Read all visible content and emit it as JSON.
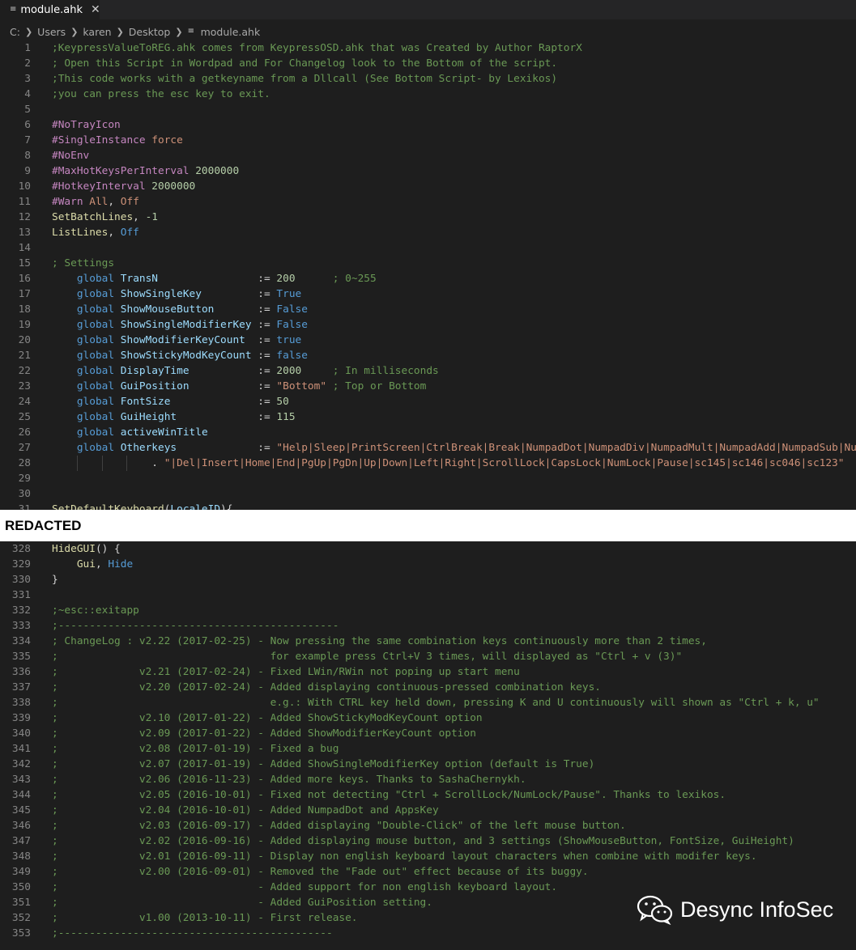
{
  "tab": {
    "icon": "file-lines-icon",
    "label": "module.ahk",
    "close_icon": "close-icon"
  },
  "breadcrumb": [
    "C:",
    "Users",
    "karen",
    "Desktop",
    "module.ahk"
  ],
  "redacted_label": "REDACTED",
  "watermark": {
    "icon": "wechat-icon",
    "text": "Desync InfoSec"
  },
  "colors": {
    "background": "#1e1e1e",
    "comment": "#6a9955",
    "directive": "#c586c0",
    "number": "#b5cea8",
    "string": "#ce9178",
    "keyword": "#569cd6",
    "function": "#dcdcaa",
    "line_number": "#858585"
  },
  "code_top": [
    {
      "n": "1",
      "t": ";KeypressValueToREG.ahk comes from KeypressOSD.ahk that was Created by Author RaptorX"
    },
    {
      "n": "2",
      "t": "; Open this Script in Wordpad and For Changelog look to the Bottom of the script."
    },
    {
      "n": "3",
      "t": ";This code works with a getkeyname from a Dllcall (See Bottom Script- by Lexikos)"
    },
    {
      "n": "4",
      "t": ";you can press the esc key to exit."
    },
    {
      "n": "5",
      "t": ""
    },
    {
      "n": "6",
      "t": "#NoTrayIcon"
    },
    {
      "n": "7",
      "t": "#SingleInstance force"
    },
    {
      "n": "8",
      "t": "#NoEnv"
    },
    {
      "n": "9",
      "t": "#MaxHotKeysPerInterval 2000000"
    },
    {
      "n": "10",
      "t": "#HotkeyInterval 2000000"
    },
    {
      "n": "11",
      "t": "#Warn All, Off"
    },
    {
      "n": "12",
      "t": "SetBatchLines, -1"
    },
    {
      "n": "13",
      "t": "ListLines, Off"
    },
    {
      "n": "14",
      "t": ""
    },
    {
      "n": "15",
      "t": "; Settings"
    },
    {
      "n": "16",
      "t": "    global TransN                := 200      ; 0~255"
    },
    {
      "n": "17",
      "t": "    global ShowSingleKey         := True"
    },
    {
      "n": "18",
      "t": "    global ShowMouseButton       := False"
    },
    {
      "n": "19",
      "t": "    global ShowSingleModifierKey := False"
    },
    {
      "n": "20",
      "t": "    global ShowModifierKeyCount  := true"
    },
    {
      "n": "21",
      "t": "    global ShowStickyModKeyCount := false"
    },
    {
      "n": "22",
      "t": "    global DisplayTime           := 2000     ; In milliseconds"
    },
    {
      "n": "23",
      "t": "    global GuiPosition           := \"Bottom\" ; Top or Bottom"
    },
    {
      "n": "24",
      "t": "    global FontSize              := 50"
    },
    {
      "n": "25",
      "t": "    global GuiHeight             := 115"
    },
    {
      "n": "26",
      "t": "    global activeWinTitle"
    },
    {
      "n": "27",
      "t": "    global Otherkeys             := \"Help|Sleep|PrintScreen|CtrlBreak|Break|NumpadDot|NumpadDiv|NumpadMult|NumpadAdd|NumpadSub|Nu"
    },
    {
      "n": "28",
      "t": "                . \"|Del|Insert|Home|End|PgUp|PgDn|Up|Down|Left|Right|ScrollLock|CapsLock|NumLock|Pause|sc145|sc146|sc046|sc123\""
    },
    {
      "n": "29",
      "t": ""
    },
    {
      "n": "30",
      "t": ""
    },
    {
      "n": "31",
      "t": "SetDefaultKeyboard(LocaleID){"
    }
  ],
  "code_bottom": [
    {
      "n": "328",
      "t": "HideGUI() {"
    },
    {
      "n": "329",
      "t": "    Gui, Hide"
    },
    {
      "n": "330",
      "t": "}"
    },
    {
      "n": "331",
      "t": ""
    },
    {
      "n": "332",
      "t": ";~esc::exitapp"
    },
    {
      "n": "333",
      "t": ";---------------------------------------------"
    },
    {
      "n": "334",
      "t": "; ChangeLog : v2.22 (2017-02-25) - Now pressing the same combination keys continuously more than 2 times,"
    },
    {
      "n": "335",
      "t": ";                                  for example press Ctrl+V 3 times, will displayed as \"Ctrl + v (3)\""
    },
    {
      "n": "336",
      "t": ";             v2.21 (2017-02-24) - Fixed LWin/RWin not poping up start menu"
    },
    {
      "n": "337",
      "t": ";             v2.20 (2017-02-24) - Added displaying continuous-pressed combination keys."
    },
    {
      "n": "338",
      "t": ";                                  e.g.: With CTRL key held down, pressing K and U continuously will shown as \"Ctrl + k, u\""
    },
    {
      "n": "339",
      "t": ";             v2.10 (2017-01-22) - Added ShowStickyModKeyCount option"
    },
    {
      "n": "340",
      "t": ";             v2.09 (2017-01-22) - Added ShowModifierKeyCount option"
    },
    {
      "n": "341",
      "t": ";             v2.08 (2017-01-19) - Fixed a bug"
    },
    {
      "n": "342",
      "t": ";             v2.07 (2017-01-19) - Added ShowSingleModifierKey option (default is True)"
    },
    {
      "n": "343",
      "t": ";             v2.06 (2016-11-23) - Added more keys. Thanks to SashaChernykh."
    },
    {
      "n": "344",
      "t": ";             v2.05 (2016-10-01) - Fixed not detecting \"Ctrl + ScrollLock/NumLock/Pause\". Thanks to lexikos."
    },
    {
      "n": "345",
      "t": ";             v2.04 (2016-10-01) - Added NumpadDot and AppsKey"
    },
    {
      "n": "346",
      "t": ";             v2.03 (2016-09-17) - Added displaying \"Double-Click\" of the left mouse button."
    },
    {
      "n": "347",
      "t": ";             v2.02 (2016-09-16) - Added displaying mouse button, and 3 settings (ShowMouseButton, FontSize, GuiHeight)"
    },
    {
      "n": "348",
      "t": ";             v2.01 (2016-09-11) - Display non english keyboard layout characters when combine with modifer keys."
    },
    {
      "n": "349",
      "t": ";             v2.00 (2016-09-01) - Removed the \"Fade out\" effect because of its buggy."
    },
    {
      "n": "350",
      "t": ";                                - Added support for non english keyboard layout."
    },
    {
      "n": "351",
      "t": ";                                - Added GuiPosition setting."
    },
    {
      "n": "352",
      "t": ";             v1.00 (2013-10-11) - First release."
    },
    {
      "n": "353",
      "t": ";--------------------------------------------"
    }
  ]
}
